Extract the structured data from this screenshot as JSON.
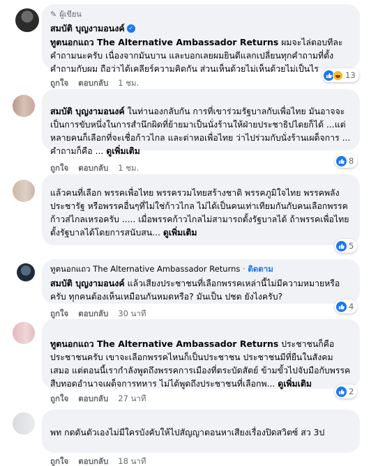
{
  "comments": [
    {
      "author_tag": "ผู้เขียน",
      "name": "สมบัติ บุญงามอนงค์",
      "mention": "ทูตนอกแถว The Alternative Ambassador Returns",
      "text": " ผมจะไล่ตอบทีละคำถามนะครับ เนื่องจากมันบาน และบอกเลยผมยินดีแลกเปลี่ยนทุกคำถามที่ตั้งคำถามกับผม ถือว่าได้เคลียร์ความคิดกัน ส่วนเห็นด้วยไม่เห็นด้วยไม่เป็นไร",
      "reactions": "13",
      "like": "ถูกใจ",
      "reply": "ตอบกลับ",
      "time": "1 ชม."
    },
    {
      "mention": "สมบัติ บุญงามอนงค์",
      "text": " ในท่านองกลับกัน การที่เขาร่วมรัฐบาลกับเพื่อไทย มันอาจจะเป็นการขับหนึ่งในการสำนึกผิดที่ย้ายมาเป็นนั่งร้านให้ฝ่ายประชาธิปไตยก็ได้ ...แต่หลายคนก็เลือกที่จะเชื่อก้าวไกล และด่าหอเพื่อไทย ว่าไปร่วมกับนั่งร้านเผด็จการ ... คำถามก็คือ ...",
      "see_more": "ดูเพิ่มเติม",
      "reactions": "8",
      "like": "ถูกใจ",
      "reply": "ตอบกลับ",
      "time": "1 ชม."
    },
    {
      "text": "แล้วคนที่เลือก พรรคเพื่อไทย พรรครวมไทยสร้างชาติ พรรคภูมิใจไทย พรรคพลังประชารัฐ หรือพรรคอื่นๆที่ไม่ใช่ก้าวไกล ไม่ได้เป็นคนเท่าเทียมกันกับคนเลือกพรรคก้าวส่ไกลเหรอครับ ..... เมื่อพรรคก้าวไกลไม่สามารถตั้งรัฐบาลได้ ถ้าพรรคเพื่อไทยตั้งรัฐบาลได้โดยการสนับสน...",
      "see_more": "ดูเพิ่มเติม",
      "reactions": "5"
    },
    {
      "header_name": "ทูตนอกแถว The Alternative Ambassador Returns",
      "follow": "ติดตาม",
      "mention": "สมบัติ บุญงามอนงค์",
      "text": " แล้วเสียงประชาชนที่เลือกพรรคเหล่านี้ไม่มีความหมายหรือครับ ทุกคนต้องเห็นเหมือนกันหมดหรือ? มันเป็น ปชต ยังไงครับ?",
      "reactions": "4",
      "like": "ถูกใจ",
      "reply": "ตอบกลับ",
      "time": "30 นาที"
    },
    {
      "mention": "ทูตนอกแถว The Alternative Ambassador Returns",
      "text": " ประชาชนก็คือประชาชนครับ เขาจะเลือกพรรคไหนก็เป็นประชาชน ประชาชนมีที่ยืนในสังคมเสมอ แต่ตอนนี้เรากำลังพูดถึงพรรคการเมืองที่ตระบัดสัตย์ ข้ามขั้วไปจับมือกับพรรคสืบทอดอำนาจเผด็จการทหาร ไม่ได้พูดถึงประชาชนที่เลือกพ...",
      "see_more": "ดูเพิ่มเติม",
      "reactions": "2",
      "like": "ถูกใจ",
      "reply": "ตอบกลับ",
      "time": "27 นาที"
    },
    {
      "text": "พท กดดันตัวเองไม่มีใครบังคับให้ไปสัญญาตอนหาเสียงเรื่องปิดสวิตซ์ สว 3ป",
      "like": "ถูกใจ",
      "reply": "ตอบกลับ",
      "time": "18 นาที"
    }
  ]
}
